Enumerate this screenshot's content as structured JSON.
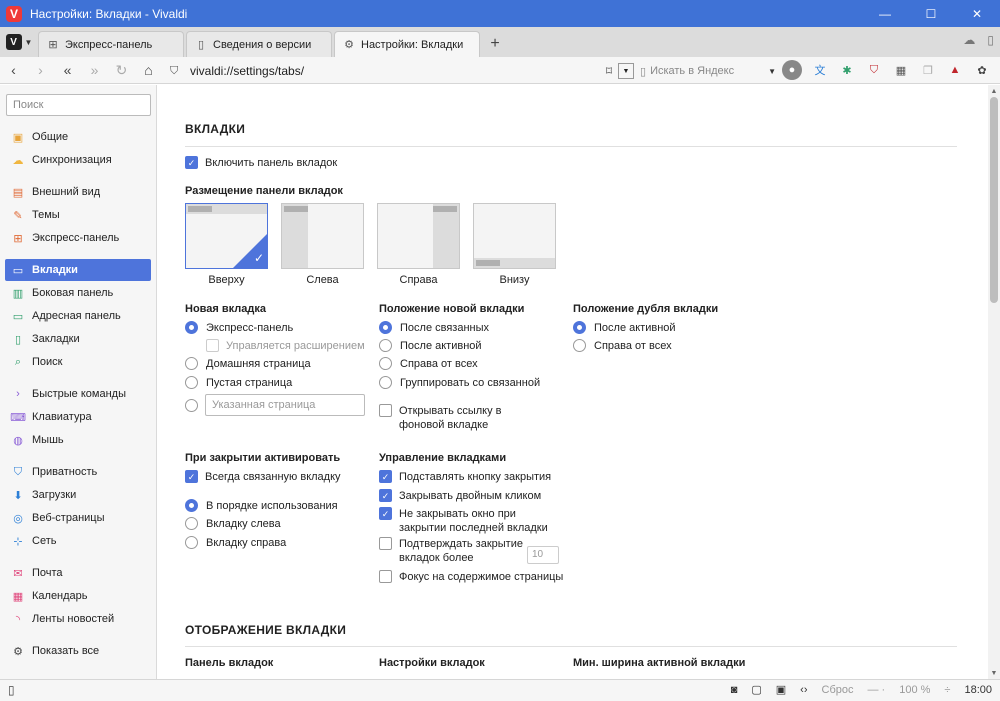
{
  "window": {
    "title": "Настройки: Вкладки - Vivaldi",
    "logo": "V",
    "minimize": "—",
    "maximize": "☐",
    "close": "✕"
  },
  "tabs": [
    {
      "label": "Экспресс-панель",
      "icon": "⊞"
    },
    {
      "label": "Сведения о версии",
      "icon": "▯"
    },
    {
      "label": "Настройки: Вкладки",
      "icon": "⚙"
    }
  ],
  "new_tab": "+",
  "address": {
    "url": "vivaldi://settings/tabs/",
    "search_placeholder": "Искать в Яндекс"
  },
  "sidebar": {
    "search_placeholder": "Поиск",
    "items": [
      {
        "label": "Общие",
        "icon": "▣",
        "color": "#e8a43a"
      },
      {
        "label": "Синхронизация",
        "icon": "☁",
        "color": "#f0b640"
      },
      {
        "label": "Внешний вид",
        "icon": "▤",
        "color": "#e06a36"
      },
      {
        "label": "Темы",
        "icon": "✎",
        "color": "#e06a36"
      },
      {
        "label": "Экспресс-панель",
        "icon": "⊞",
        "color": "#e06a36"
      },
      {
        "label": "Вкладки",
        "icon": "▭",
        "color": "#ffffff"
      },
      {
        "label": "Боковая панель",
        "icon": "▥",
        "color": "#2f9e6b"
      },
      {
        "label": "Адресная панель",
        "icon": "▭",
        "color": "#2f9e6b"
      },
      {
        "label": "Закладки",
        "icon": "▯",
        "color": "#2f9e6b"
      },
      {
        "label": "Поиск",
        "icon": "⌕",
        "color": "#2f9e6b"
      },
      {
        "label": "Быстрые команды",
        "icon": "›",
        "color": "#8a5ed6"
      },
      {
        "label": "Клавиатура",
        "icon": "⌨",
        "color": "#8a5ed6"
      },
      {
        "label": "Мышь",
        "icon": "◍",
        "color": "#8a5ed6"
      },
      {
        "label": "Приватность",
        "icon": "⛉",
        "color": "#2c7fd6"
      },
      {
        "label": "Загрузки",
        "icon": "⬇",
        "color": "#2c7fd6"
      },
      {
        "label": "Веб-страницы",
        "icon": "◎",
        "color": "#2c7fd6"
      },
      {
        "label": "Сеть",
        "icon": "⊹",
        "color": "#2c7fd6"
      },
      {
        "label": "Почта",
        "icon": "✉",
        "color": "#e0457b"
      },
      {
        "label": "Календарь",
        "icon": "▦",
        "color": "#e0457b"
      },
      {
        "label": "Ленты новостей",
        "icon": "◝",
        "color": "#e0457b"
      },
      {
        "label": "Показать все",
        "icon": "⚙",
        "color": "#444444"
      }
    ]
  },
  "settings": {
    "section_tabs": "ВКЛАДКИ",
    "enable_tabbar": "Включить панель вкладок",
    "placement_label": "Размещение панели вкладок",
    "placement": [
      "Вверху",
      "Слева",
      "Справа",
      "Внизу"
    ],
    "new_tab": {
      "label": "Новая вкладка",
      "options": [
        "Экспресс-панель",
        "Управляется расширением",
        "Домашняя страница",
        "Пустая страница"
      ],
      "custom_placeholder": "Указанная страница"
    },
    "new_tab_position": {
      "label": "Положение новой вкладки",
      "options": [
        "После связанных",
        "После активной",
        "Справа от всех",
        "Группировать со связанной"
      ],
      "open_bg": "Открывать ссылку в фоновой вкладке"
    },
    "dup_position": {
      "label": "Положение дубля вкладки",
      "options": [
        "После активной",
        "Справа от всех"
      ]
    },
    "on_close": {
      "label": "При закрытии активировать",
      "always_related": "Всегда связанную вкладку",
      "options": [
        "В порядке использования",
        "Вкладку слева",
        "Вкладку справа"
      ]
    },
    "tab_handling": {
      "label": "Управление вкладками",
      "close_button": "Подставлять кнопку закрытия",
      "dbl_click": "Закрывать двойным кликом",
      "keep_window": "Не закрывать окно при закрытии последней вкладки",
      "confirm_close": "Подтверждать закрытие вкладок более",
      "confirm_count": "10",
      "focus_content": "Фокус на содержимое страницы"
    },
    "section_display": "ОТОБРАЖЕНИЕ ВКЛАДКИ",
    "tab_panel_label": "Панель вкладок",
    "tab_settings_label": "Настройки вкладок",
    "min_width_label": "Мин. ширина активной вкладки"
  },
  "status": {
    "reset": "Сброс",
    "zoom": "100 %",
    "time": "18:00"
  },
  "colors": {
    "accent": "#4e74db",
    "titlebar": "#3f72d6"
  }
}
